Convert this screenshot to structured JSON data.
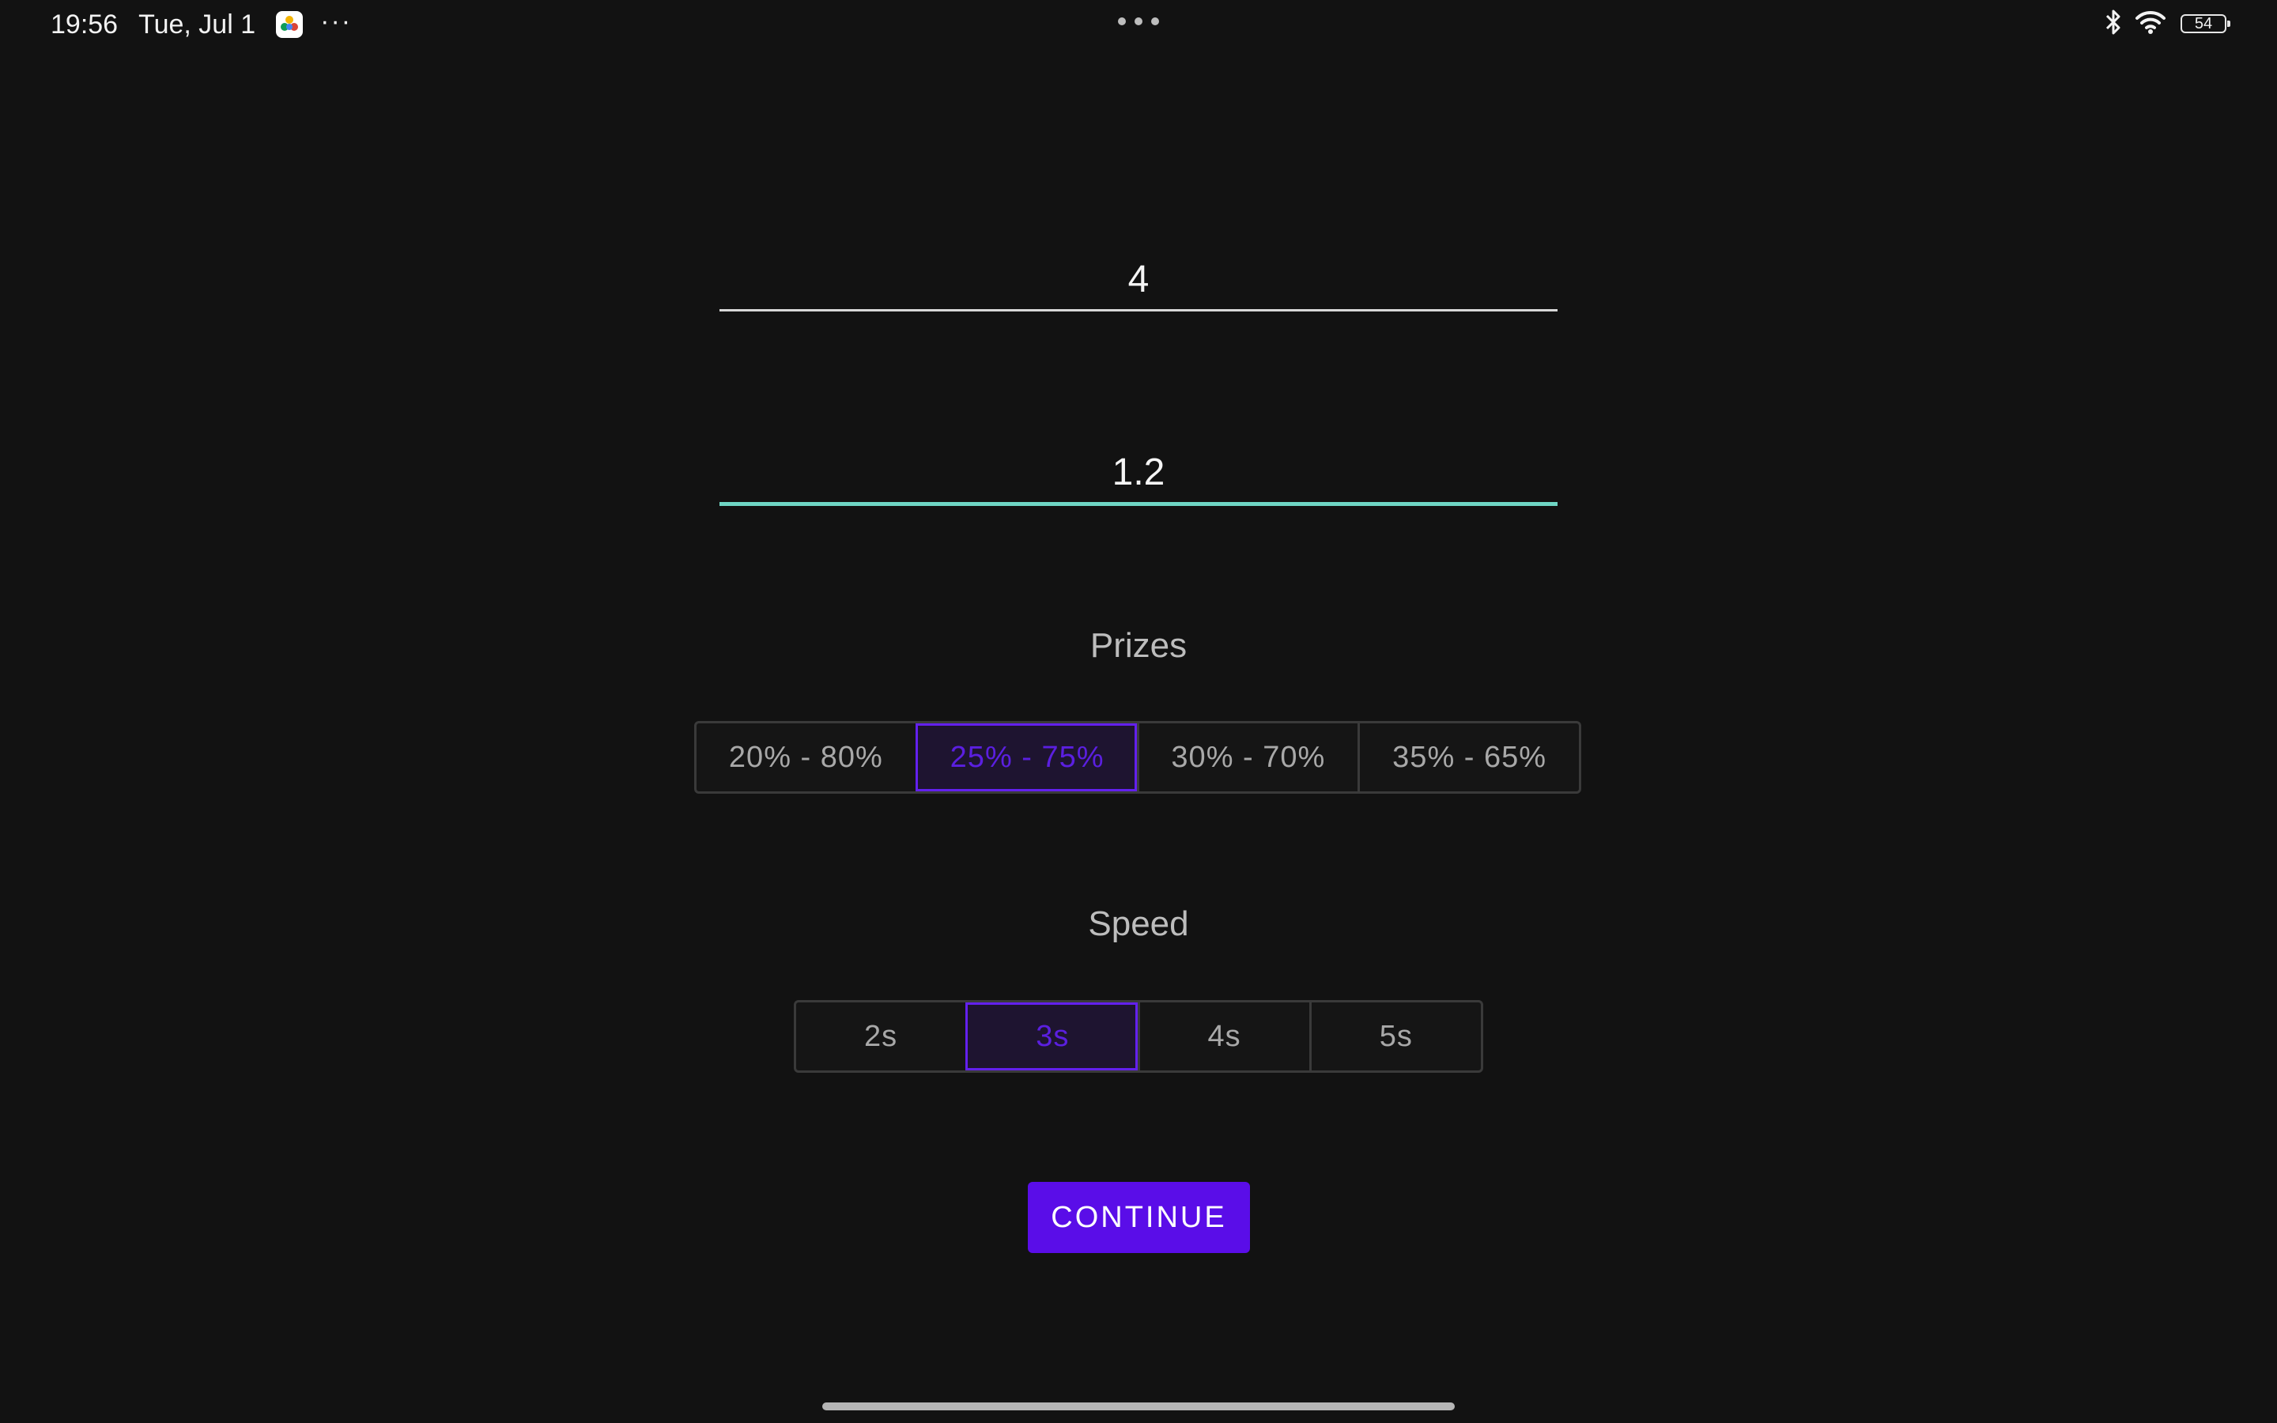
{
  "status_bar": {
    "time": "19:56",
    "date": "Tue, Jul 1",
    "more": "···",
    "battery_level": "54",
    "icons": [
      "app-icon",
      "bluetooth-icon",
      "wifi-icon",
      "battery-icon"
    ]
  },
  "form": {
    "field_1": {
      "value": "4"
    },
    "field_2": {
      "value": "1.2",
      "focused": true
    }
  },
  "prizes": {
    "label": "Prizes",
    "options": [
      "20% - 80%",
      "25% - 75%",
      "30% - 70%",
      "35% - 65%"
    ],
    "selected": "25% - 75%"
  },
  "speed": {
    "label": "Speed",
    "options": [
      "2s",
      "3s",
      "4s",
      "5s"
    ],
    "selected": "3s"
  },
  "continue_button": {
    "label": "CONTINUE"
  },
  "colors": {
    "background": "#121212",
    "accent": "#5a0de8",
    "focus_underline": "#6fd6c4",
    "segment_border": "#3a3a3a"
  }
}
